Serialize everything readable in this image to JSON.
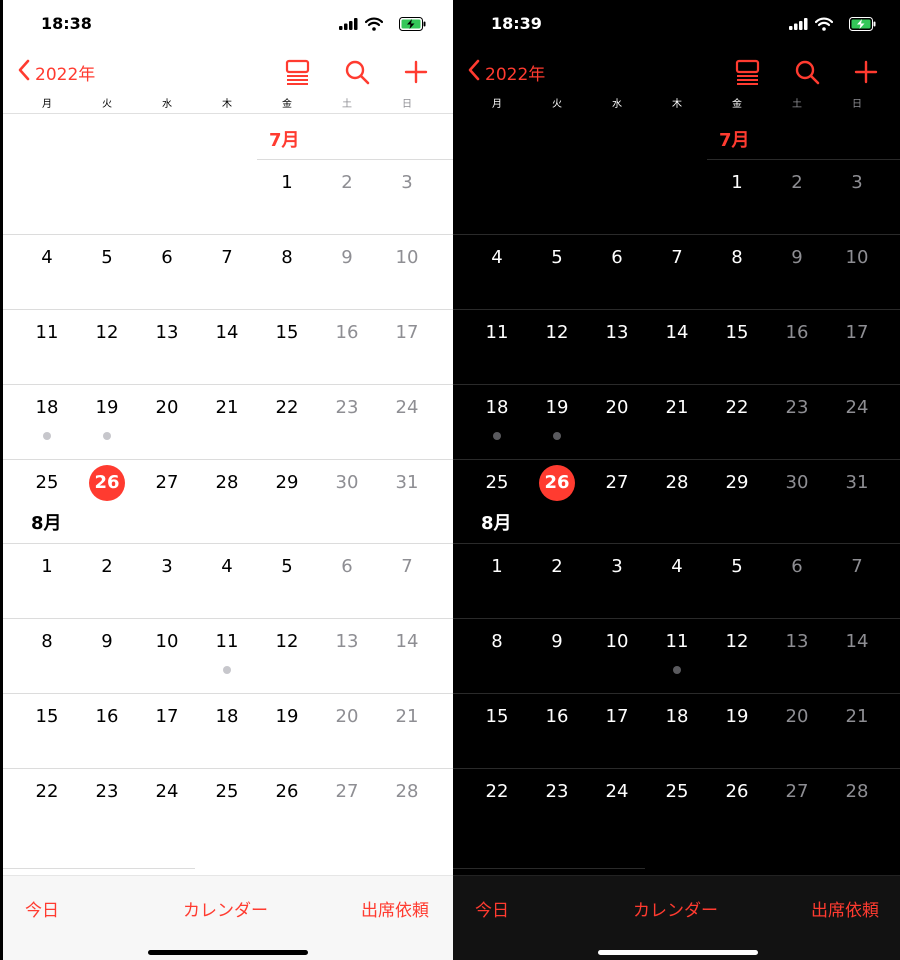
{
  "phones": [
    {
      "theme": "light",
      "status_bar": {
        "time": "18:38"
      },
      "nav": {
        "back_label": "2022年"
      },
      "weekdays": [
        "月",
        "火",
        "水",
        "木",
        "金",
        "土",
        "日"
      ],
      "toolbar": {
        "today": "今日",
        "calendars": "カレンダー",
        "inbox": "出席依頼"
      }
    },
    {
      "theme": "dark",
      "status_bar": {
        "time": "18:39"
      },
      "nav": {
        "back_label": "2022年"
      },
      "weekdays": [
        "月",
        "火",
        "水",
        "木",
        "金",
        "土",
        "日"
      ],
      "toolbar": {
        "today": "今日",
        "calendars": "カレンダー",
        "inbox": "出席依頼"
      }
    }
  ],
  "months": [
    {
      "label": "7月",
      "is_current": true,
      "weeks": [
        [
          "",
          "",
          "",
          "",
          "1",
          "2",
          "3"
        ],
        [
          "4",
          "5",
          "6",
          "7",
          "8",
          "9",
          "10"
        ],
        [
          "11",
          "12",
          "13",
          "14",
          "15",
          "16",
          "17"
        ],
        [
          "18",
          "19",
          "20",
          "21",
          "22",
          "23",
          "24"
        ],
        [
          "25",
          "26",
          "27",
          "28",
          "29",
          "30",
          "31"
        ]
      ]
    },
    {
      "label": "8月",
      "is_current": false,
      "weeks": [
        [
          "1",
          "2",
          "3",
          "4",
          "5",
          "6",
          "7"
        ],
        [
          "8",
          "9",
          "10",
          "11",
          "12",
          "13",
          "14"
        ],
        [
          "15",
          "16",
          "17",
          "18",
          "19",
          "20",
          "21"
        ],
        [
          "22",
          "23",
          "24",
          "25",
          "26",
          "27",
          "28"
        ]
      ]
    }
  ],
  "today": {
    "month_index": 0,
    "day": "26"
  },
  "event_days": [
    {
      "month_index": 0,
      "day": "18"
    },
    {
      "month_index": 0,
      "day": "19"
    },
    {
      "month_index": 1,
      "day": "11"
    }
  ],
  "colors": {
    "accent": "#ff3b30",
    "weekend_text": "#8e8e93",
    "event_dot_light": "#c7c7cc",
    "event_dot_dark": "#5a5a5e"
  },
  "icons": {
    "back": "chevron-left-icon",
    "list_view": "list-view-icon",
    "search": "search-icon",
    "add": "plus-icon",
    "signal": "cellular-signal-icon",
    "wifi": "wifi-icon",
    "battery": "battery-charging-icon"
  }
}
